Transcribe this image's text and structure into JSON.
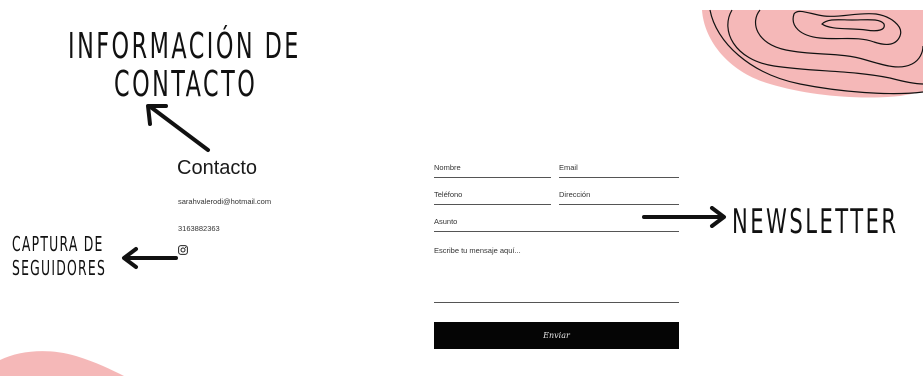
{
  "annotations": {
    "info_line1": "INFORMACIÓN DE",
    "info_line2": "CONTACTO",
    "capture_line1": "CAPTURA DE",
    "capture_line2": "SEGUIDORES",
    "newsletter": "NEWSLETTER"
  },
  "contact": {
    "title": "Contacto",
    "email": "sarahvalerodi@hotmail.com",
    "phone": "3163882363",
    "social_icon": "instagram-icon"
  },
  "form": {
    "name_label": "Nombre",
    "email_label": "Email",
    "phone_label": "Teléfono",
    "address_label": "Dirección",
    "subject_label": "Asunto",
    "message_placeholder": "Escribe tu mensaje aquí...",
    "submit_label": "Enviar"
  },
  "colors": {
    "accent_pink": "#f5b8b8",
    "button_bg": "#050505",
    "text": "#111111"
  }
}
